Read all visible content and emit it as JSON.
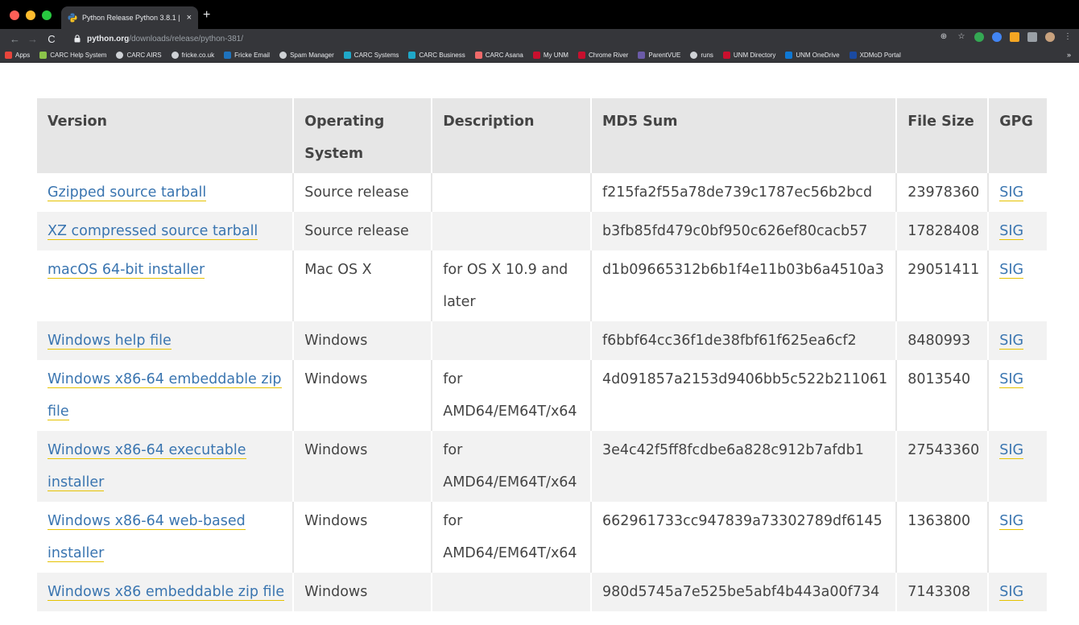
{
  "browser": {
    "tab_title": "Python Release Python 3.8.1 | P",
    "tab_close": "×",
    "new_tab": "+",
    "url_host": "python.org",
    "url_path": "/downloads/release/python-381/",
    "bookmarks": [
      {
        "label": "Apps",
        "icon": "apps-grid-icon",
        "color": "#e8453c"
      },
      {
        "label": "CARC Help System",
        "icon": "checkmark-shield-icon",
        "color": "#8bc34a"
      },
      {
        "label": "CARC AIRS",
        "icon": "globe-icon",
        "color": "#cfd2d6"
      },
      {
        "label": "fricke.co.uk",
        "icon": "globe-icon",
        "color": "#cfd2d6"
      },
      {
        "label": "Fricke Email",
        "icon": "outlook-icon",
        "color": "#1e73be"
      },
      {
        "label": "Spam Manager",
        "icon": "globe-icon",
        "color": "#cfd2d6"
      },
      {
        "label": "CARC Systems",
        "icon": "jira-icon",
        "color": "#1fa8c9"
      },
      {
        "label": "CARC Business",
        "icon": "jira-icon",
        "color": "#1fa8c9"
      },
      {
        "label": "CARC Asana",
        "icon": "asana-icon",
        "color": "#f06a6a"
      },
      {
        "label": "My UNM",
        "icon": "unm-icon",
        "color": "#c8102e"
      },
      {
        "label": "Chrome River",
        "icon": "unm-icon",
        "color": "#c8102e"
      },
      {
        "label": "ParentVUE",
        "icon": "parentvue-icon",
        "color": "#6b5ba8"
      },
      {
        "label": "runs",
        "icon": "globe-icon",
        "color": "#cfd2d6"
      },
      {
        "label": "UNM Directory",
        "icon": "unm-icon",
        "color": "#c8102e"
      },
      {
        "label": "UNM OneDrive",
        "icon": "onedrive-icon",
        "color": "#0f78d4"
      },
      {
        "label": "XDMoD Portal",
        "icon": "xdmod-icon",
        "color": "#1b4aa1"
      }
    ],
    "bookmarks_more": "»"
  },
  "table": {
    "headers": [
      "Version",
      "Operating System",
      "Description",
      "MD5 Sum",
      "File Size",
      "GPG"
    ],
    "rows": [
      {
        "version": "Gzipped source tarball",
        "os": "Source release",
        "description": "",
        "md5": "f215fa2f55a78de739c1787ec56b2bcd",
        "size": "23978360",
        "gpg": "SIG"
      },
      {
        "version": "XZ compressed source tarball",
        "os": "Source release",
        "description": "",
        "md5": "b3fb85fd479c0bf950c626ef80cacb57",
        "size": "17828408",
        "gpg": "SIG"
      },
      {
        "version": "macOS 64-bit installer",
        "os": "Mac OS X",
        "description": "for OS X 10.9 and later",
        "md5": "d1b09665312b6b1f4e11b03b6a4510a3",
        "size": "29051411",
        "gpg": "SIG"
      },
      {
        "version": "Windows help file",
        "os": "Windows",
        "description": "",
        "md5": "f6bbf64cc36f1de38fbf61f625ea6cf2",
        "size": "8480993",
        "gpg": "SIG"
      },
      {
        "version": "Windows x86-64 embeddable zip file",
        "os": "Windows",
        "description": "for AMD64/EM64T/x64",
        "md5": "4d091857a2153d9406bb5c522b211061",
        "size": "8013540",
        "gpg": "SIG"
      },
      {
        "version": "Windows x86-64 executable installer",
        "os": "Windows",
        "description": "for AMD64/EM64T/x64",
        "md5": "3e4c42f5ff8fcdbe6a828c912b7afdb1",
        "size": "27543360",
        "gpg": "SIG"
      },
      {
        "version": "Windows x86-64 web-based installer",
        "os": "Windows",
        "description": "for AMD64/EM64T/x64",
        "md5": "662961733cc947839a73302789df6145",
        "size": "1363800",
        "gpg": "SIG"
      },
      {
        "version": "Windows x86 embeddable zip file",
        "os": "Windows",
        "description": "",
        "md5": "980d5745a7e525be5abf4b443a00f734",
        "size": "7143308",
        "gpg": "SIG"
      }
    ]
  }
}
